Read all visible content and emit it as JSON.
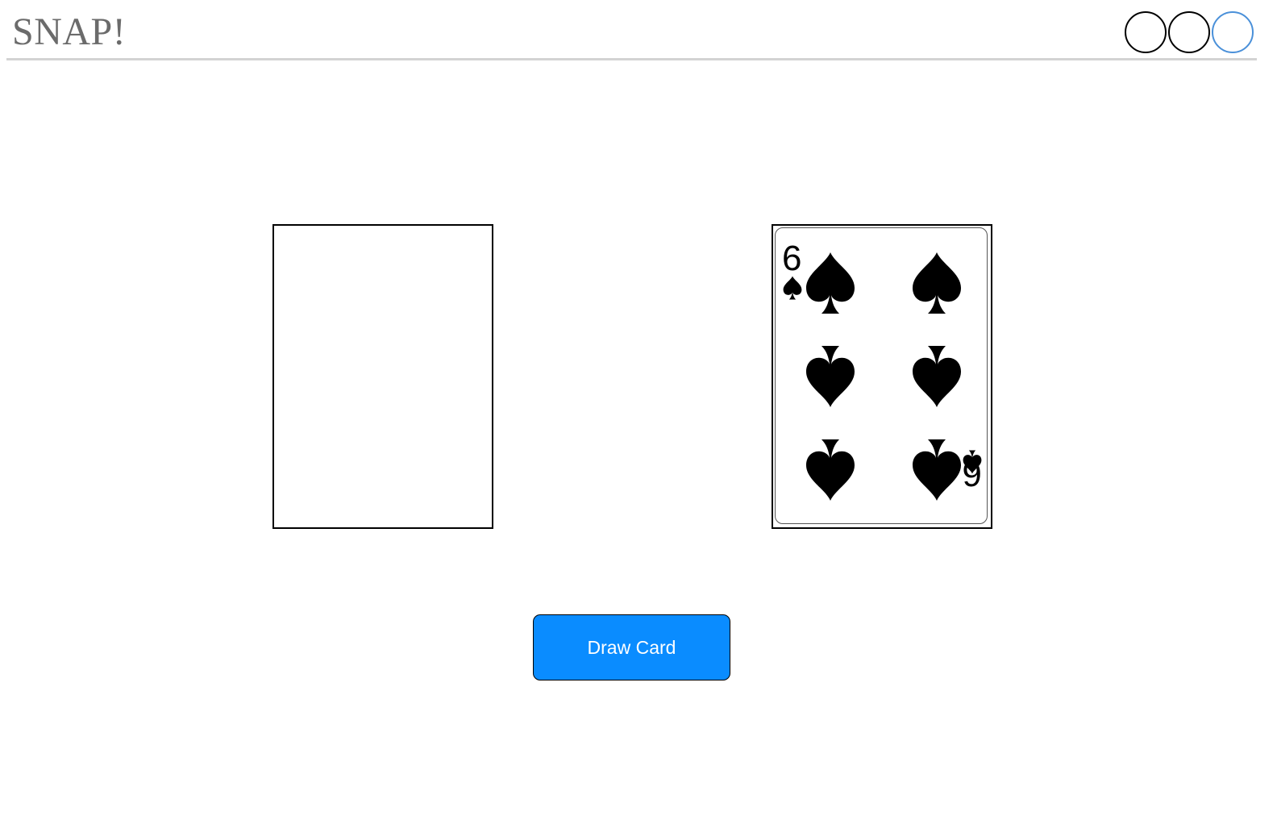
{
  "header": {
    "title": "SNAP!",
    "indicators": [
      {
        "state": "off",
        "color": "#000000"
      },
      {
        "state": "off",
        "color": "#000000"
      },
      {
        "state": "active",
        "color": "#4a90d9"
      }
    ]
  },
  "table": {
    "left_card": {
      "state": "empty"
    },
    "right_card": {
      "state": "face-up",
      "rank": "6",
      "suit": "spades",
      "suit_icon": "spade-icon"
    }
  },
  "controls": {
    "draw_label": "Draw Card",
    "draw_color": "#0a8cff"
  }
}
